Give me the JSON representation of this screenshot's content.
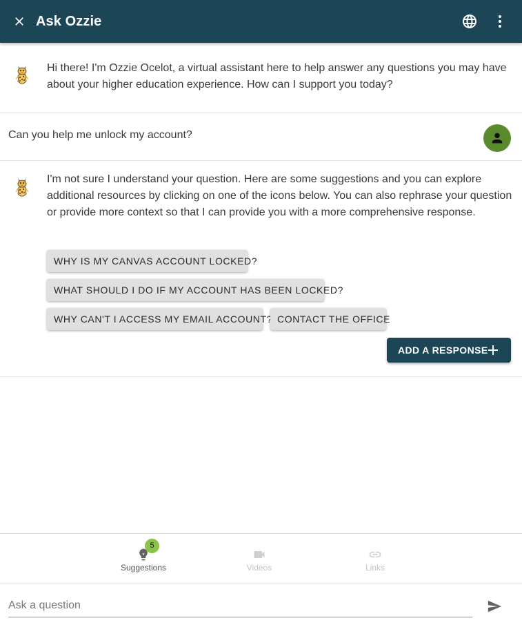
{
  "header": {
    "title": "Ask Ozzie",
    "icons": {
      "close": "close-icon",
      "language": "globe-icon",
      "menu": "more-vert-icon"
    }
  },
  "conversation": {
    "bot_greeting": "Hi there! I'm Ozzie Ocelot, a virtual assistant here to help answer any questions you may have about your higher education experience. How can I support you today?",
    "user_message": "Can you help me unlock my account?",
    "bot_reply": "I'm not sure I understand your question. Here are some suggestions and you can explore additional resources by clicking on one of the icons below. You can also rephrase your question or provide more context so that I can provide you with a more comprehensive response.",
    "suggestions": [
      "Why is my Canvas account locked?",
      "What should I do if my account has been locked?",
      "Why can't I access my email account?",
      "Contact the office"
    ],
    "add_response_label": "ADD A RESPONSE"
  },
  "resources": {
    "tabs": [
      {
        "label": "Suggestions",
        "icon": "lightbulb-icon",
        "enabled": true
      },
      {
        "label": "Videos",
        "icon": "videocam-icon",
        "enabled": false
      },
      {
        "label": "Links",
        "icon": "link-icon",
        "enabled": false
      }
    ],
    "suggestions_count": "5"
  },
  "input": {
    "placeholder": "Ask a question",
    "value": ""
  },
  "colors": {
    "header_bg": "#1c4556",
    "user_avatar_bg": "#5a8a2e",
    "badge_bg": "#8bc34a",
    "chip_bg": "#e0e0e0"
  }
}
